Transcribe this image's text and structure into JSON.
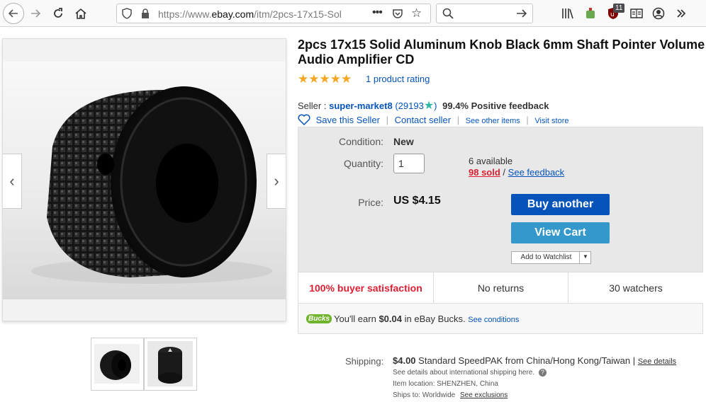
{
  "browser": {
    "url_prefix": "https://www.",
    "url_host": "ebay.com",
    "url_path": "/itm/2pcs-17x15-Sol",
    "ublock_count": "11"
  },
  "listing": {
    "title": "2pcs 17x15 Solid Aluminum Knob Black 6mm Shaft Pointer Volume Audio Amplifier CD",
    "stars": "★★★★★",
    "rating_text": "1 product rating"
  },
  "seller": {
    "label": "Seller :",
    "name": "super-market8",
    "score_open": "(29193",
    "score_close": ")",
    "feedback": "99.4% Positive feedback",
    "save_seller": "Save this Seller",
    "contact": "Contact seller",
    "other_items": "See other items",
    "visit_store": "Visit store"
  },
  "purchase": {
    "condition_label": "Condition:",
    "condition_value": "New",
    "quantity_label": "Quantity:",
    "quantity_value": "1",
    "available": "6 available",
    "sold": "98 sold",
    "sep": "/",
    "see_feedback": "See feedback",
    "price_label": "Price:",
    "price_value": "US $4.15",
    "buy_button": "Buy another",
    "cart_button": "View Cart",
    "watchlist_button": "Add to Watchlist"
  },
  "stats": {
    "satisfaction": "100% buyer satisfaction",
    "returns": "No returns",
    "watchers": "30 watchers"
  },
  "bucks": {
    "logo": "Bucks",
    "earn_prefix": "You'll earn",
    "earn_amount": "$0.04",
    "earn_suffix": "in eBay Bucks.",
    "conditions": "See conditions"
  },
  "shipping": {
    "label": "Shipping:",
    "cost": "$4.00",
    "method": "Standard SpeedPAK from China/Hong Kong/Taiwan |",
    "details": "See details",
    "intl_note": "See details about international shipping here.",
    "location": "Item location:  SHENZHEN, China",
    "ships_to": "Ships to:  Worldwide",
    "exclusions": "See exclusions"
  },
  "colors": {
    "link": "#0654ba",
    "buy": "#0654ba",
    "cart": "#3498ca",
    "star": "#f5a623",
    "satisfaction": "#dd1e31",
    "bucks_green": "#6fb42c"
  }
}
